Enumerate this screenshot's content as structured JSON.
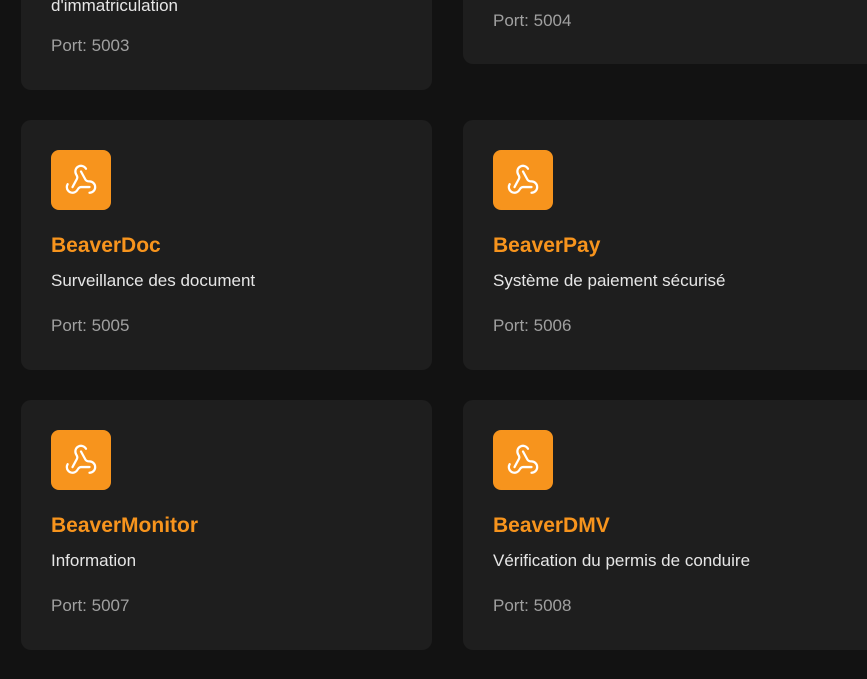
{
  "colors": {
    "accent": "#f7941d",
    "background": "#121212",
    "card": "#1e1e1e",
    "text": "#e6e6e6",
    "muted": "#a0a0a0"
  },
  "cards": [
    {
      "name": "",
      "description": "d'immatriculation",
      "port": "Port: 5003",
      "icon": "webhook-icon"
    },
    {
      "name": "",
      "description": "",
      "port": "Port: 5004",
      "icon": "webhook-icon"
    },
    {
      "name": "BeaverDoc",
      "description": "Surveillance des document",
      "port": "Port: 5005",
      "icon": "webhook-icon"
    },
    {
      "name": "BeaverPay",
      "description": "Système de paiement sécurisé",
      "port": "Port: 5006",
      "icon": "webhook-icon"
    },
    {
      "name": "BeaverMonitor",
      "description": "Information",
      "port": "Port: 5007",
      "icon": "webhook-icon"
    },
    {
      "name": "BeaverDMV",
      "description": "Vérification du permis de conduire",
      "port": "Port: 5008",
      "icon": "webhook-icon"
    }
  ]
}
